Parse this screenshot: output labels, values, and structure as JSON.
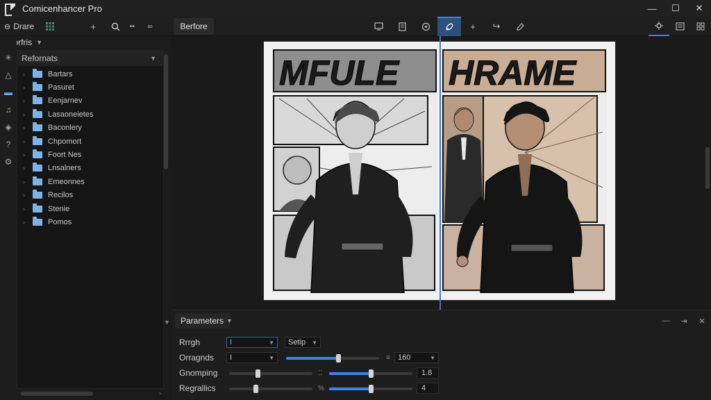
{
  "app": {
    "title": "Comicenhancer Pro"
  },
  "window": {
    "minimize": "—",
    "maximize": "☐",
    "close": "✕"
  },
  "toolbar": {
    "drive_label": "Drare",
    "before_label": "Berfore"
  },
  "panel": {
    "header_label": "Forfris",
    "tree_header": "Refornats",
    "items": [
      {
        "label": "Bartars"
      },
      {
        "label": "Pasuret"
      },
      {
        "label": "Eenjarnev"
      },
      {
        "label": "Lasaoneietes"
      },
      {
        "label": "Baconlery"
      },
      {
        "label": "Chpomort"
      },
      {
        "label": "Foort Nes"
      },
      {
        "label": "Lnsalners"
      },
      {
        "label": "Emeonnes"
      },
      {
        "label": "Recilos"
      },
      {
        "label": "Stenie"
      },
      {
        "label": "Pomos"
      }
    ]
  },
  "canvas": {
    "left_title": "MFULE",
    "right_title": "HRAME"
  },
  "params": {
    "tab_label": "Parameters",
    "rows": [
      {
        "label": "Rrrgh",
        "dropdown1": "I",
        "dropdown2": "Setip"
      },
      {
        "label": "Orragnds",
        "dropdown1": "I",
        "slider_value": 0.56,
        "value": "160"
      },
      {
        "label": "Gnomping",
        "slider1_value": 0.34,
        "slider2_value": 0.5,
        "value": "1.8"
      },
      {
        "label": "Regrallics",
        "slider1_value": 0.32,
        "slider2_value": 0.5,
        "value": "4"
      }
    ]
  },
  "colors": {
    "accent": "#3b82f6",
    "folder": "#7fb3e6",
    "bg": "#1b1b1b"
  }
}
